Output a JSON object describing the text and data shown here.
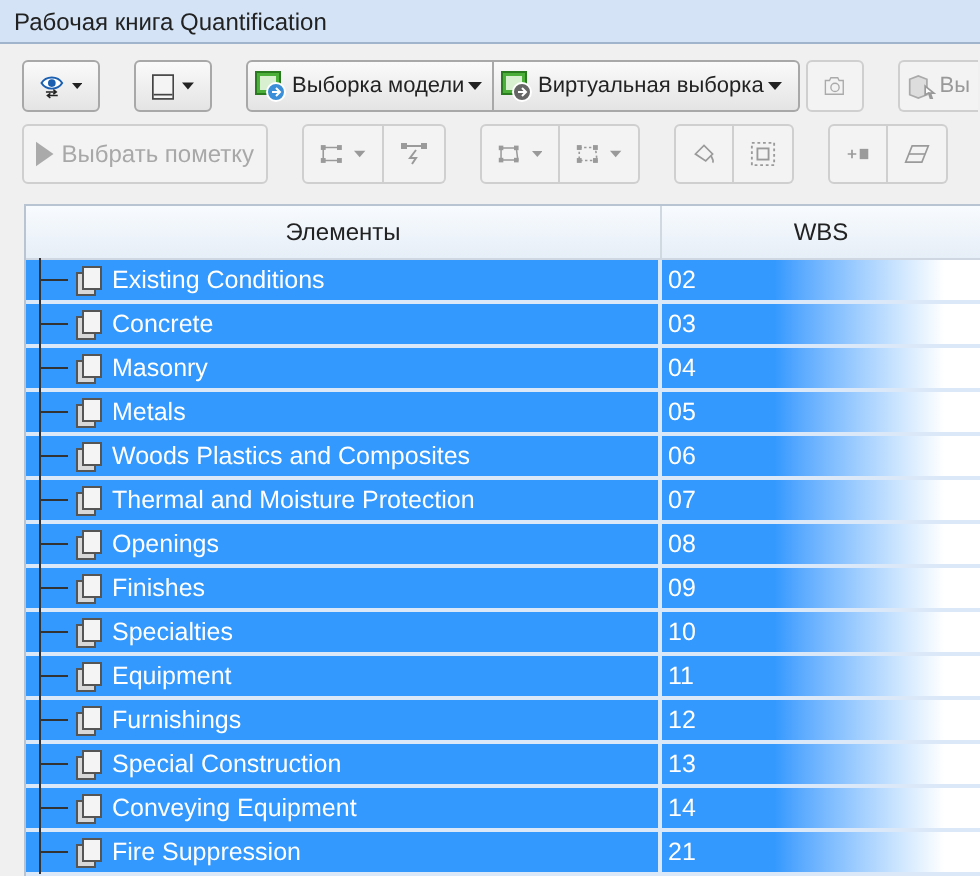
{
  "window": {
    "title": "Рабочая книга Quantification"
  },
  "toolbar_row_1": [
    {
      "kind": "view",
      "disabled": false
    },
    {
      "kind": "book",
      "disabled": false
    },
    {
      "kind": "split",
      "items": [
        {
          "label": "Выборка модели",
          "disabled": false
        },
        {
          "label": "Виртуальная выборка",
          "disabled": false
        }
      ]
    },
    {
      "kind": "camera",
      "disabled": true
    },
    {
      "kind": "cut",
      "label": "Вы",
      "disabled": true
    }
  ],
  "toolbar_row_2": [
    {
      "kind": "label",
      "label": "Выбрать пометку",
      "disabled": true
    },
    {
      "kind": "group",
      "tools": [
        {
          "kind": "polyline"
        },
        {
          "kind": "lightning"
        }
      ],
      "disabled": true
    },
    {
      "kind": "group",
      "tools": [
        {
          "kind": "area"
        },
        {
          "kind": "area-dashed"
        }
      ],
      "disabled": true
    },
    {
      "kind": "group",
      "tools": [
        {
          "kind": "fill"
        },
        {
          "kind": "select-box"
        }
      ],
      "disabled": true
    },
    {
      "kind": "group",
      "tools": [
        {
          "kind": "add"
        },
        {
          "kind": "eraser"
        }
      ],
      "disabled": true
    }
  ],
  "table": {
    "columns": [
      "Элементы",
      "WBS"
    ],
    "rows": [
      {
        "name": "Existing Conditions",
        "wbs": "02",
        "selected": true
      },
      {
        "name": "Concrete",
        "wbs": "03",
        "selected": true
      },
      {
        "name": "Masonry",
        "wbs": "04",
        "selected": true
      },
      {
        "name": "Metals",
        "wbs": "05",
        "selected": true
      },
      {
        "name": "Woods Plastics and Composites",
        "wbs": "06",
        "selected": true
      },
      {
        "name": "Thermal and Moisture Protection",
        "wbs": "07",
        "selected": true
      },
      {
        "name": "Openings",
        "wbs": "08",
        "selected": true
      },
      {
        "name": "Finishes",
        "wbs": "09",
        "selected": true
      },
      {
        "name": "Specialties",
        "wbs": "10",
        "selected": true
      },
      {
        "name": "Equipment",
        "wbs": "11",
        "selected": true
      },
      {
        "name": "Furnishings",
        "wbs": "12",
        "selected": true
      },
      {
        "name": "Special Construction",
        "wbs": "13",
        "selected": true
      },
      {
        "name": "Conveying Equipment",
        "wbs": "14",
        "selected": true
      },
      {
        "name": "Fire Suppression",
        "wbs": "21",
        "selected": true
      }
    ]
  }
}
